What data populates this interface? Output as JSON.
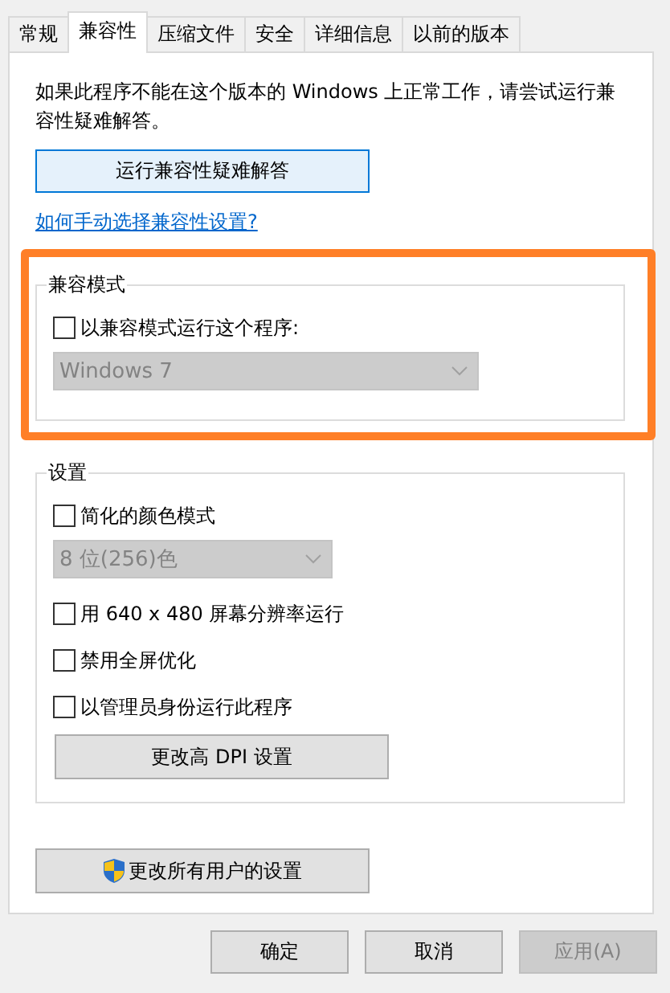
{
  "tabs": [
    {
      "label": "常规",
      "selected": false
    },
    {
      "label": "兼容性",
      "selected": true
    },
    {
      "label": "压缩文件",
      "selected": false
    },
    {
      "label": "安全",
      "selected": false
    },
    {
      "label": "详细信息",
      "selected": false
    },
    {
      "label": "以前的版本",
      "selected": false
    }
  ],
  "intro": "如果此程序不能在这个版本的 Windows 上正常工作，请尝试运行兼容性疑难解答。",
  "troubleshoot_button": "运行兼容性疑难解答",
  "help_link": "如何手动选择兼容性设置?",
  "compat_group": {
    "title": "兼容模式",
    "highlighted": true,
    "items": [
      {
        "kind": "checkbox",
        "label": "以兼容模式运行这个程序:",
        "checked": false
      },
      {
        "kind": "dropdown",
        "value": "Windows 7",
        "disabled": true
      }
    ]
  },
  "settings_group": {
    "title": "设置",
    "items": [
      {
        "kind": "checkbox",
        "label": "简化的颜色模式",
        "checked": false
      },
      {
        "kind": "dropdown",
        "value": "8 位(256)色",
        "disabled": true
      },
      {
        "kind": "checkbox",
        "label": "用 640 x 480 屏幕分辨率运行",
        "checked": false
      },
      {
        "kind": "checkbox",
        "label": "禁用全屏优化",
        "checked": false
      },
      {
        "kind": "checkbox",
        "label": "以管理员身份运行此程序",
        "checked": false
      },
      {
        "kind": "button",
        "label": "更改高 DPI 设置"
      }
    ]
  },
  "all_users_button": {
    "label": "更改所有用户的设置",
    "shield": true
  },
  "footer_buttons": [
    {
      "label": "确定",
      "disabled": false
    },
    {
      "label": "取消",
      "disabled": false
    },
    {
      "label": "应用(A)",
      "disabled": true
    }
  ]
}
